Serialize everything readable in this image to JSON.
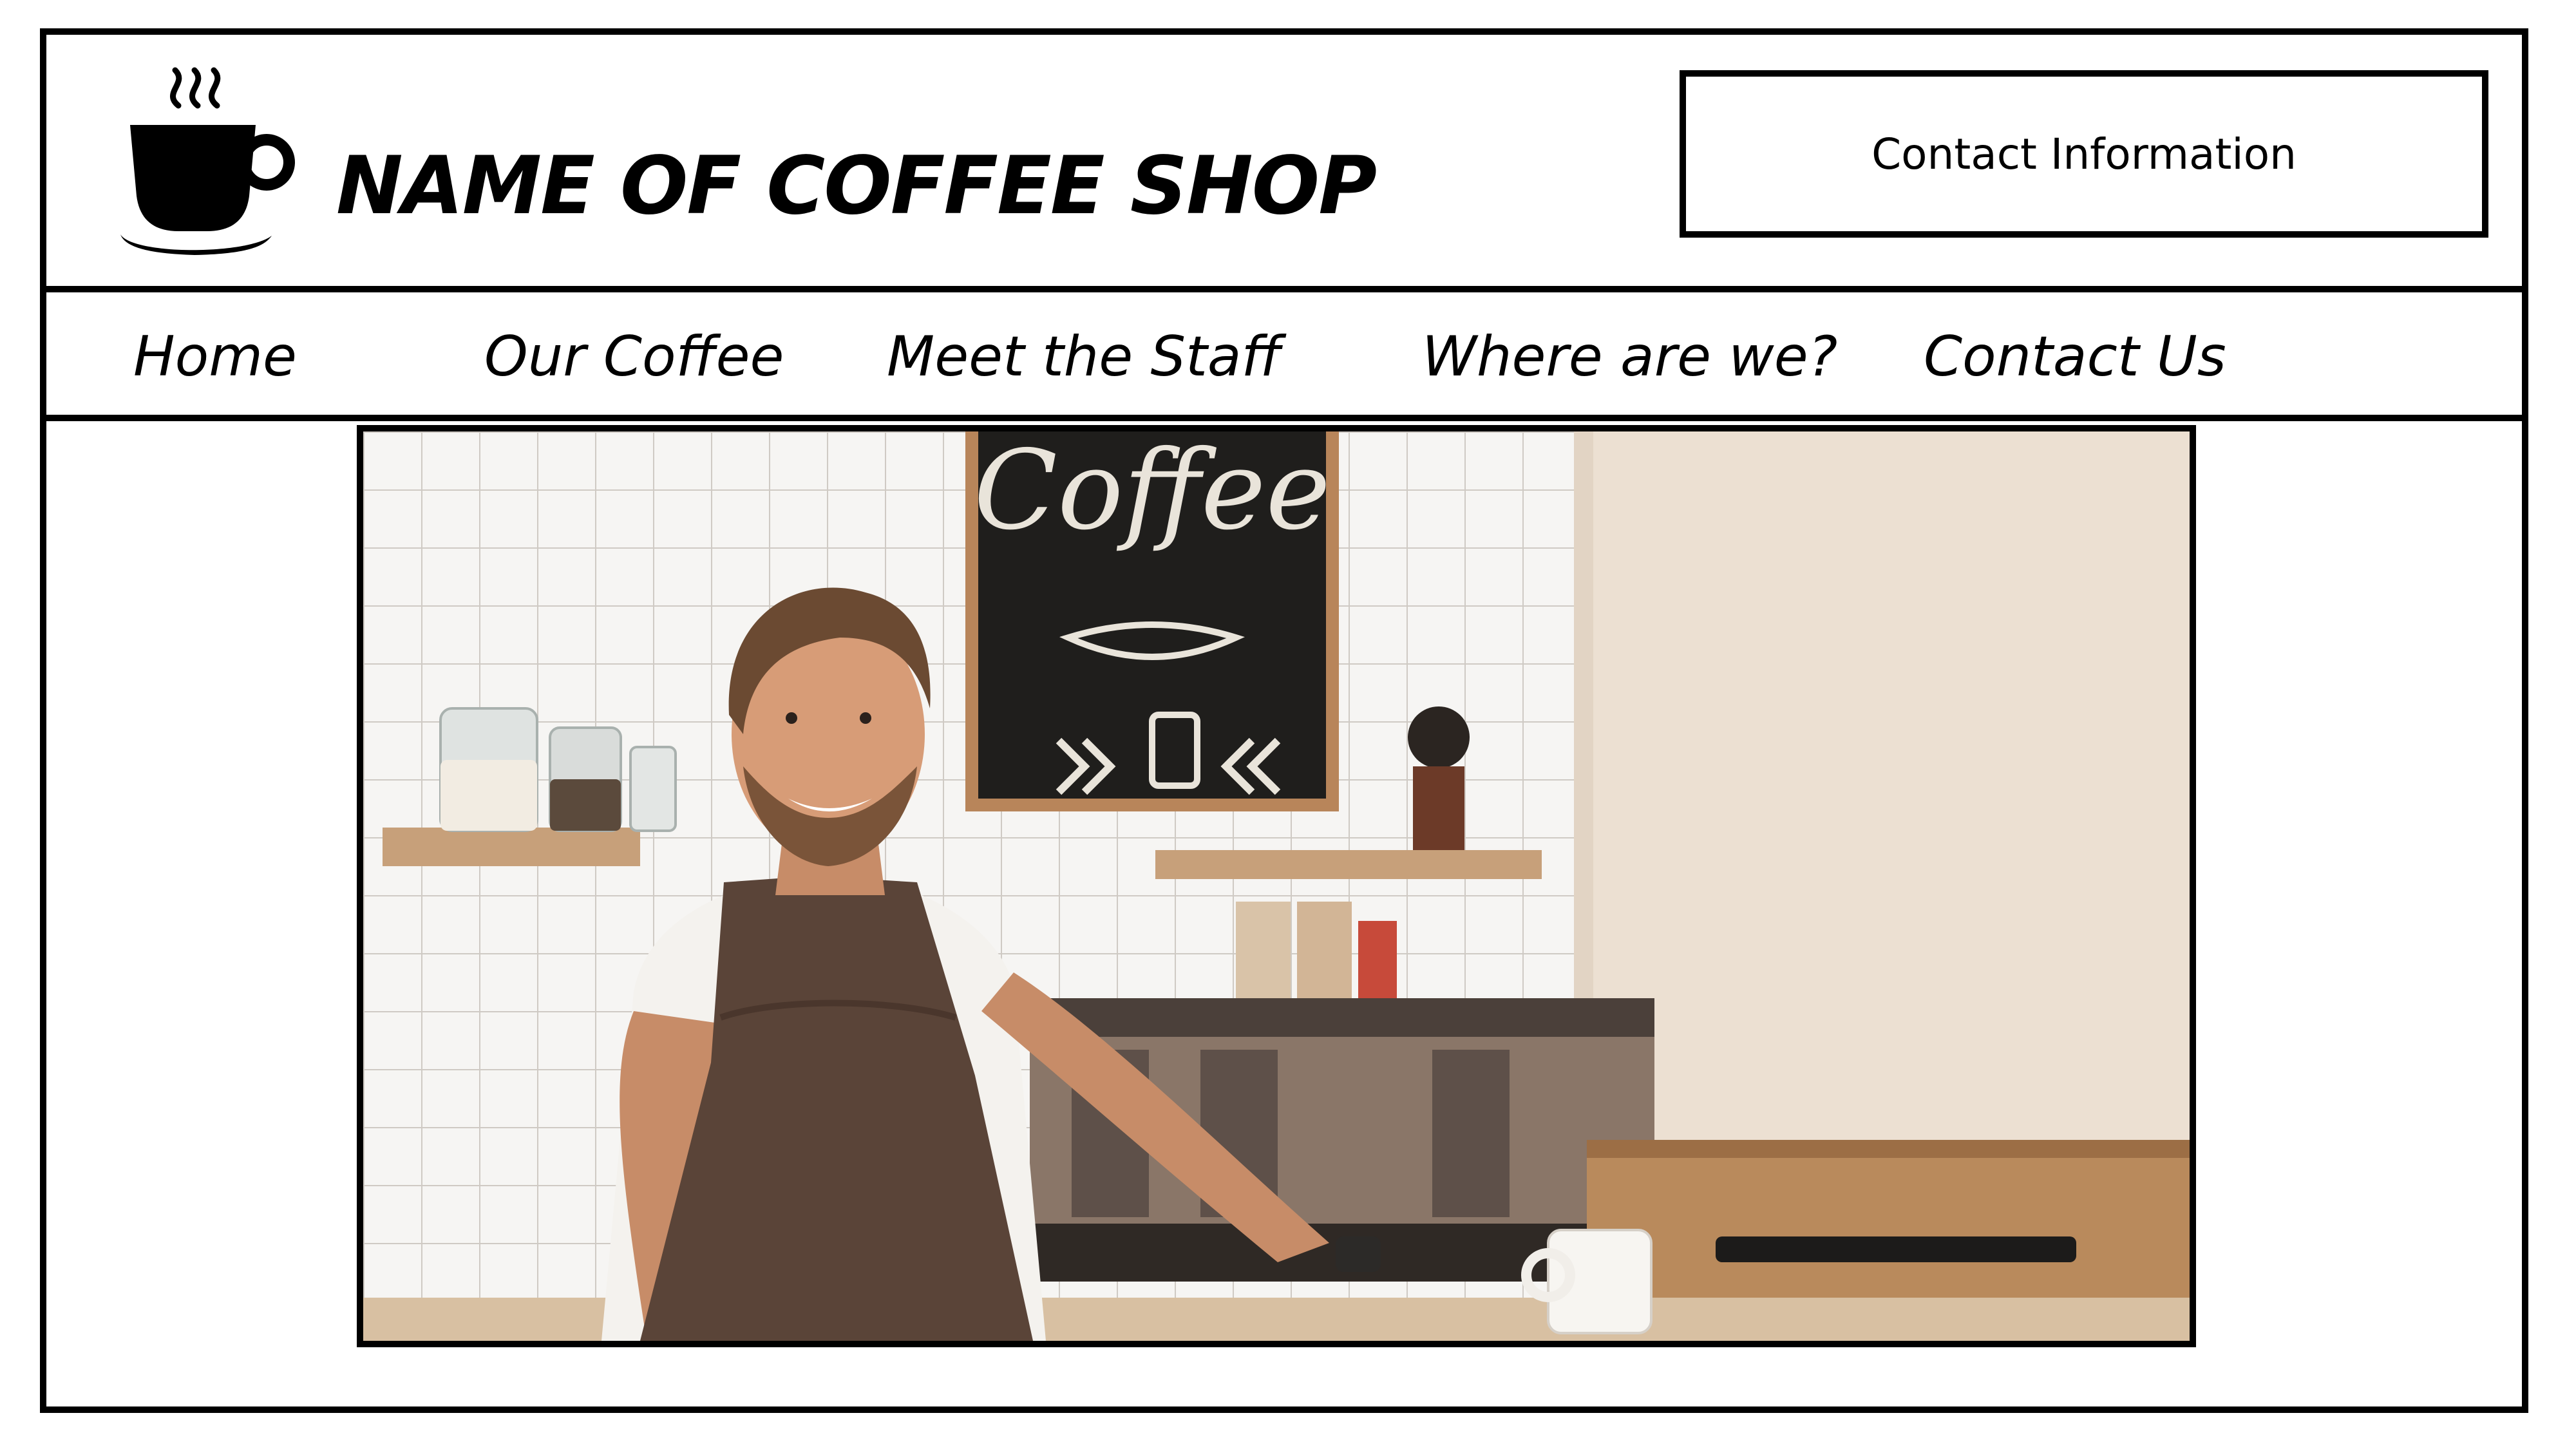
{
  "header": {
    "logo_icon": "coffee-cup-icon",
    "shop_name": "NAME OF COFFEE SHOP",
    "contact_info": "Contact Information"
  },
  "nav": {
    "items": [
      {
        "label": "Home"
      },
      {
        "label": "Our Coffee"
      },
      {
        "label": "Meet the Staff"
      },
      {
        "label": "Where are we?"
      },
      {
        "label": "Contact Us"
      }
    ]
  },
  "hero": {
    "image": "smiling-barista-photo",
    "chalkboard_text": "Coffee"
  },
  "colors": {
    "border": "#000000",
    "background": "#ffffff",
    "apron": "#5a4438",
    "wall": "#efe6dc"
  }
}
